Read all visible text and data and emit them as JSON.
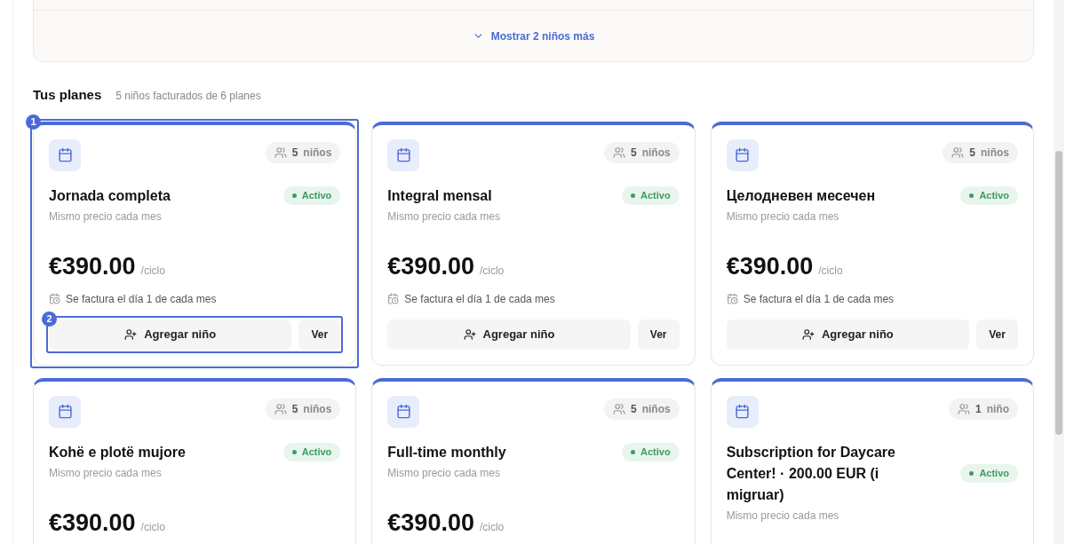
{
  "show_more": {
    "label": "Mostrar 2 niños más"
  },
  "section": {
    "title": "Tus planes",
    "subtitle": "5 niños facturados de 6 planes"
  },
  "plans": [
    {
      "count": "5",
      "unit": "niños",
      "title": "Jornada completa",
      "status": "Activo",
      "subtitle": "Mismo precio cada mes",
      "price": "€390.00",
      "period": "/ciclo",
      "billing": "Se factura el día 1 de cada mes",
      "add_label": "Agregar niño",
      "view_label": "Ver",
      "annotation": "1",
      "actions_annotation": "2"
    },
    {
      "count": "5",
      "unit": "niños",
      "title": "Integral mensal",
      "status": "Activo",
      "subtitle": "Mismo precio cada mes",
      "price": "€390.00",
      "period": "/ciclo",
      "billing": "Se factura el día 1 de cada mes",
      "add_label": "Agregar niño",
      "view_label": "Ver"
    },
    {
      "count": "5",
      "unit": "niños",
      "title": "Целодневен месечен",
      "status": "Activo",
      "subtitle": "Mismo precio cada mes",
      "price": "€390.00",
      "period": "/ciclo",
      "billing": "Se factura el día 1 de cada mes",
      "add_label": "Agregar niño",
      "view_label": "Ver"
    },
    {
      "count": "5",
      "unit": "niños",
      "title": "Kohë e plotë mujore",
      "status": "Activo",
      "subtitle": "Mismo precio cada mes",
      "price": "€390.00",
      "period": "/ciclo"
    },
    {
      "count": "5",
      "unit": "niños",
      "title": "Full-time monthly",
      "status": "Activo",
      "subtitle": "Mismo precio cada mes",
      "price": "€390.00",
      "period": "/ciclo"
    },
    {
      "count": "1",
      "unit": "niño",
      "title": "Subscription for Daycare Center! · 200.00 EUR (i migruar)",
      "status": "Activo",
      "subtitle": "Mismo precio cada mes"
    }
  ]
}
